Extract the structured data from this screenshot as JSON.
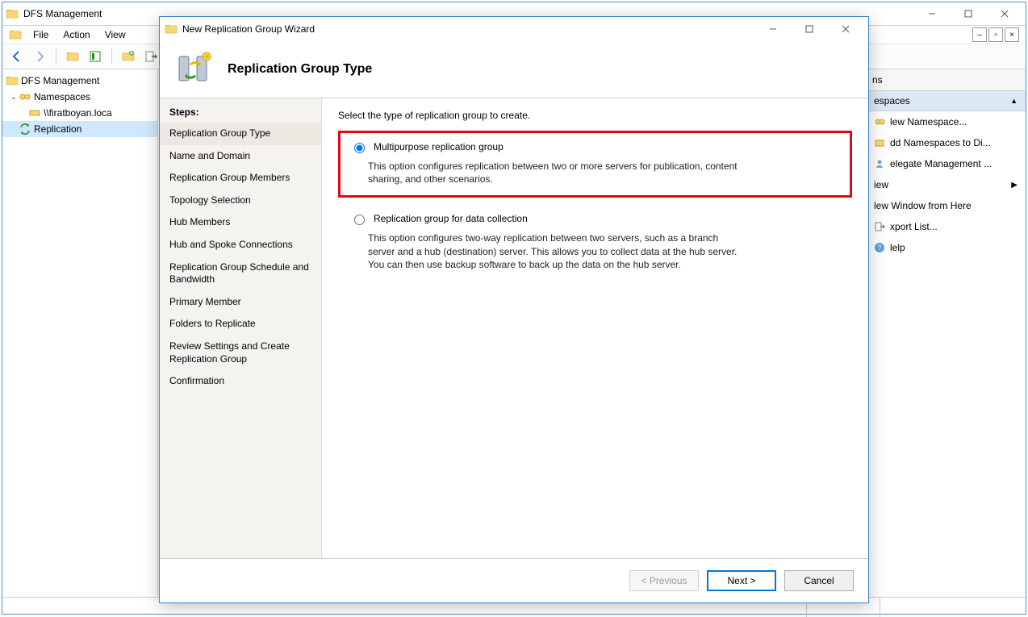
{
  "main_window": {
    "title": "DFS Management",
    "menubar": [
      "File",
      "Action",
      "View"
    ],
    "tree": {
      "root": "DFS Management",
      "items": [
        {
          "label": "Namespaces",
          "expanded": true,
          "indent": 1
        },
        {
          "label": "\\\\firatboyan.loca",
          "indent": 2
        },
        {
          "label": "Replication",
          "indent": 1,
          "selected": true
        }
      ]
    },
    "actions": {
      "title": "ns",
      "group": "espaces",
      "items": [
        "lew Namespace...",
        "dd Namespaces to Di...",
        "elegate Management ...",
        "iew",
        "lew Window from Here",
        "xport List...",
        "lelp"
      ]
    }
  },
  "wizard": {
    "title": "New Replication Group Wizard",
    "heading": "Replication Group Type",
    "steps_label": "Steps:",
    "steps": [
      "Replication Group Type",
      "Name and Domain",
      "Replication Group Members",
      "Topology Selection",
      "Hub Members",
      "Hub and Spoke Connections",
      "Replication Group Schedule and Bandwidth",
      "Primary Member",
      "Folders to Replicate",
      "Review Settings and Create Replication Group",
      "Confirmation"
    ],
    "instruction": "Select the type of replication group to create.",
    "options": [
      {
        "label": "Multipurpose replication group",
        "desc": "This option configures replication between two or more servers for publication, content sharing, and other scenarios.",
        "checked": true,
        "highlight": true
      },
      {
        "label": "Replication group for data collection",
        "desc": "This option configures two-way replication between two servers, such as a branch server and a hub (destination) server. This allows you to collect data at the hub server. You can then use backup software to back up the data on the hub server.",
        "checked": false,
        "highlight": false
      }
    ],
    "buttons": {
      "prev": "< Previous",
      "next": "Next >",
      "cancel": "Cancel"
    }
  }
}
